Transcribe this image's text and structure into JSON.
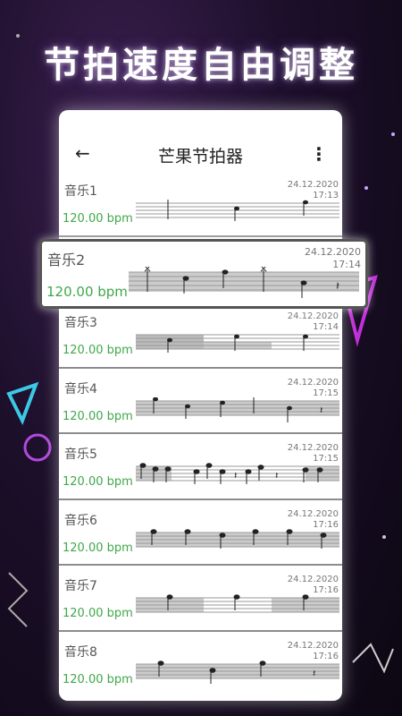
{
  "headline": "节拍速度自由调整",
  "app": {
    "title": "芒果节拍器",
    "back_icon": "arrow-left-icon",
    "menu_icon": "more-vertical-icon"
  },
  "items": [
    {
      "name": "音乐1",
      "date": "24.12.2020",
      "time": "17:13",
      "bpm": "120.00 bpm"
    },
    {
      "name": "音乐2",
      "date": "24.12.2020",
      "time": "17:14",
      "bpm": "120.00 bpm"
    },
    {
      "name": "音乐3",
      "date": "24.12.2020",
      "time": "17:14",
      "bpm": "120.00 bpm"
    },
    {
      "name": "音乐4",
      "date": "24.12.2020",
      "time": "17:15",
      "bpm": "120.00 bpm"
    },
    {
      "name": "音乐5",
      "date": "24.12.2020",
      "time": "17:15",
      "bpm": "120.00 bpm"
    },
    {
      "name": "音乐6",
      "date": "24.12.2020",
      "time": "17:16",
      "bpm": "120.00 bpm"
    },
    {
      "name": "音乐7",
      "date": "24.12.2020",
      "time": "17:16",
      "bpm": "120.00 bpm"
    },
    {
      "name": "音乐8",
      "date": "24.12.2020",
      "time": "17:16",
      "bpm": "120.00 bpm"
    }
  ],
  "colors": {
    "bpm": "#3fa84a",
    "accent_purple": "#b04adf",
    "accent_cyan": "#3cc9e6"
  }
}
